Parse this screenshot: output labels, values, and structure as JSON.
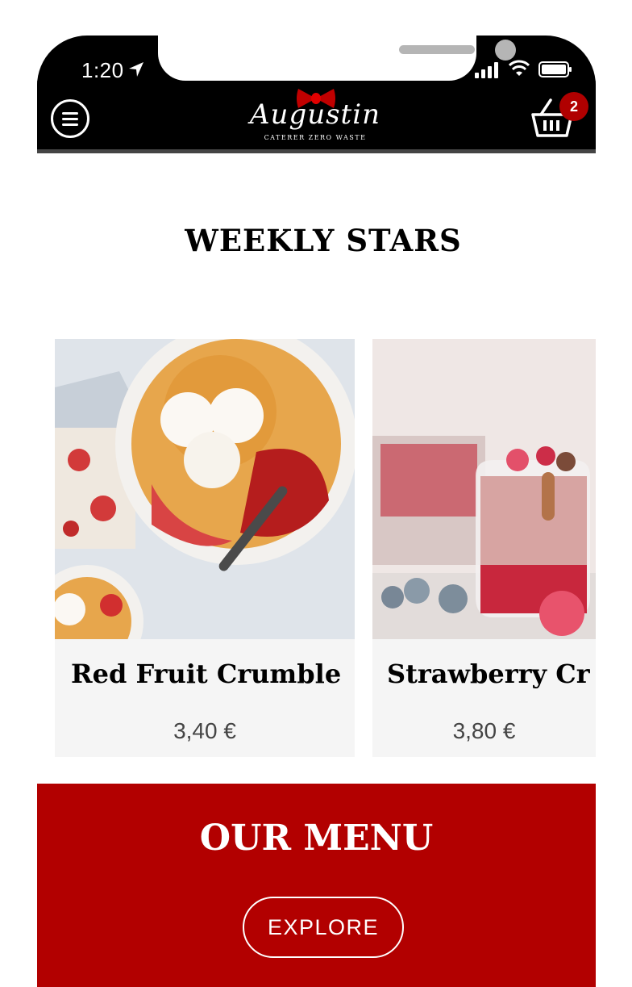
{
  "status_bar": {
    "time": "1:20"
  },
  "header": {
    "logo_text": "Augustin",
    "logo_subtitle": "CATERER ZERO WASTE",
    "cart_count": "2",
    "menu_icon": "hamburger-icon",
    "cart_icon": "basket-icon"
  },
  "weekly_stars": {
    "title": "WEEKLY STARS",
    "items": [
      {
        "name": "Red Fruit Crumble",
        "price": "3,40 €",
        "image": "red-fruit-crumble-photo"
      },
      {
        "name": "Strawberry Cr",
        "price": "3,80 €",
        "image": "strawberry-dessert-jar-photo"
      }
    ]
  },
  "menu_section": {
    "title": "OUR MENU",
    "button_label": "EXPLORE"
  },
  "colors": {
    "brand_red": "#b20000",
    "badge_red": "#b00000",
    "header_black": "#000000",
    "card_bg": "#f5f5f5"
  }
}
